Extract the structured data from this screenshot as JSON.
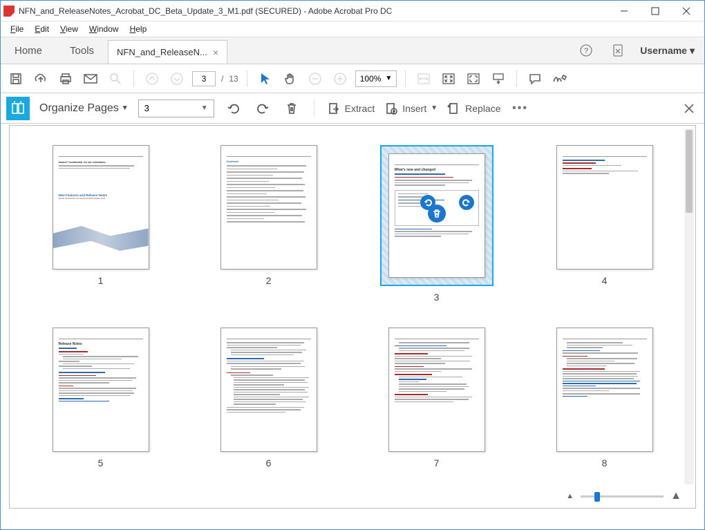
{
  "window": {
    "title": "NFN_and_ReleaseNotes_Acrobat_DC_Beta_Update_3_M1.pdf (SECURED) - Adobe Acrobat Pro DC"
  },
  "menu": {
    "file": "File",
    "edit": "Edit",
    "view": "View",
    "window": "Window",
    "help": "Help"
  },
  "tabs": {
    "home": "Home",
    "tools": "Tools",
    "doc": "NFN_and_ReleaseN..."
  },
  "user": {
    "name": "Username"
  },
  "toolbar": {
    "page_current": "3",
    "page_sep": "/",
    "page_total": "13",
    "zoom": "100%"
  },
  "organize": {
    "title": "Organize Pages",
    "page_selected": "3",
    "extract": "Extract",
    "insert": "Insert",
    "replace": "Replace"
  },
  "thumbnails": {
    "nums": [
      "1",
      "2",
      "3",
      "4",
      "5",
      "6",
      "7",
      "8"
    ],
    "selected_index": 2,
    "page1": {
      "title": "New Features and Release Notes",
      "sub": "Adobe Acrobat DC (Continuous) Beta Update 3 M1"
    },
    "page2": {
      "title": "Contents"
    },
    "page3": {
      "title": "What's new and changed"
    },
    "page5": {
      "title": "Release Notes"
    }
  }
}
